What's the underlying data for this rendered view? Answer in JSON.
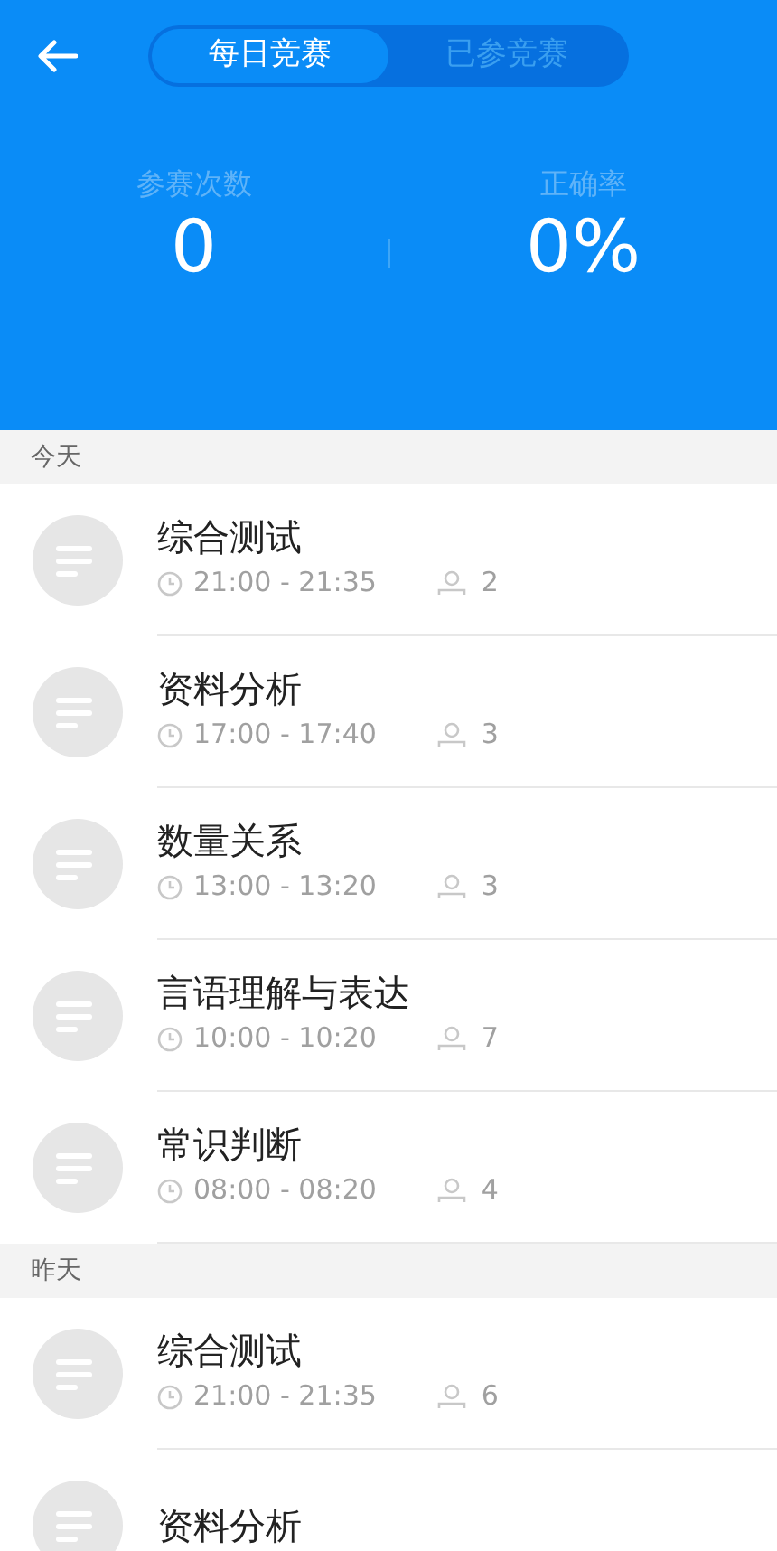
{
  "tabs": [
    {
      "label": "每日竞赛",
      "selected": true
    },
    {
      "label": "已参竞赛",
      "selected": false
    }
  ],
  "stats": [
    {
      "label": "参赛次数",
      "value": "0"
    },
    {
      "label": "正确率",
      "value": "0%"
    }
  ],
  "sections": [
    {
      "title": "今天",
      "items": [
        {
          "name": "综合测试",
          "time": "21:00 - 21:35",
          "count": "2"
        },
        {
          "name": "资料分析",
          "time": "17:00 - 17:40",
          "count": "3"
        },
        {
          "name": "数量关系",
          "time": "13:00 - 13:20",
          "count": "3"
        },
        {
          "name": "言语理解与表达",
          "time": "10:00 - 10:20",
          "count": "7"
        },
        {
          "name": "常识判断",
          "time": "08:00 - 08:20",
          "count": "4"
        }
      ]
    },
    {
      "title": "昨天",
      "items": [
        {
          "name": "综合测试",
          "time": "21:00 - 21:35",
          "count": "6"
        },
        {
          "name": "资料分析"
        }
      ]
    }
  ]
}
